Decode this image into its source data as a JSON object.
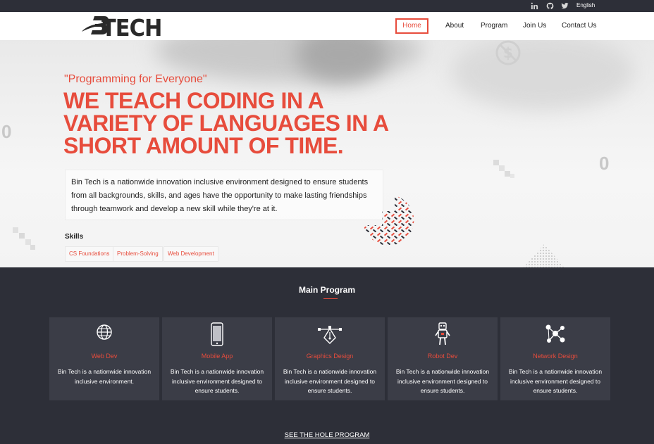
{
  "topbar": {
    "social": [
      "linkedin-icon",
      "github-icon",
      "twitter-icon"
    ],
    "language": "English"
  },
  "brand": {
    "name": "TECH",
    "mark": "B"
  },
  "nav": [
    "Home",
    "About",
    "Program",
    "Join Us",
    "Contact Us"
  ],
  "hero": {
    "tagline": "\"Programming for Everyone\"",
    "headline": "WE TEACH CODING IN A VARIETY OF LANGUAGES IN A SHORT AMOUNT OF TIME.",
    "description": "Bin Tech is a nationwide innovation inclusive environment designed to ensure students from all backgrounds, skills, and ages have the opportunity to make lasting friendships through teamwork and develop a new skill while they're at it.",
    "skills_title": "Skills",
    "skills": [
      "CS Foundations",
      "Problem-Solving",
      "Web Development"
    ],
    "decor_digits": [
      "0",
      "0"
    ]
  },
  "program": {
    "title": "Main Program",
    "cards": [
      {
        "icon": "globe-icon",
        "title": "Web Dev",
        "desc": "Bin Tech is a nationwide innovation inclusive environment."
      },
      {
        "icon": "smartphone-icon",
        "title": "Mobile App",
        "desc": "Bin Tech is a nationwide innovation inclusive environment designed to ensure students."
      },
      {
        "icon": "pen-tool-icon",
        "title": "Graphics Design",
        "desc": "Bin Tech is a nationwide innovation inclusive environment designed to ensure students."
      },
      {
        "icon": "robot-icon",
        "title": "Robot Dev",
        "desc": "Bin Tech is a nationwide innovation inclusive environment designed to ensure students."
      },
      {
        "icon": "network-icon",
        "title": "Network Design",
        "desc": "Bin Tech is a nationwide innovation inclusive environment designed to ensure students."
      }
    ],
    "see_all": "SEE THE HOLE PROGRAM"
  },
  "colors": {
    "accent": "#e74c3c",
    "dark": "#2d2f38",
    "card": "#3b3d47"
  }
}
